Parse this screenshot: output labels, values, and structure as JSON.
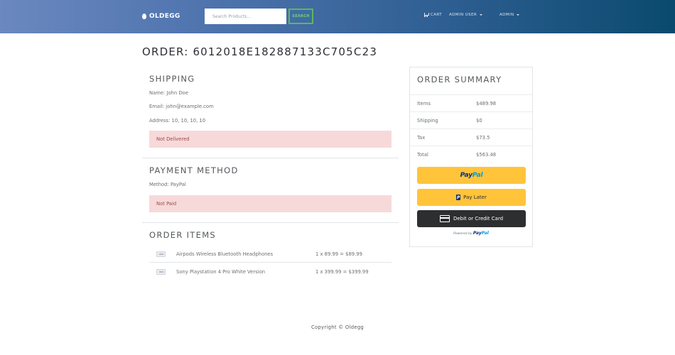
{
  "navbar": {
    "brand": "OLDEGG",
    "search_placeholder": "Search Products...",
    "search_button": "SEARCH",
    "cart": "CART",
    "user_menu": "ADMIN USER",
    "admin_menu": "ADMIN"
  },
  "order": {
    "title": "ORDER: 6012018E182887133C705C23"
  },
  "shipping": {
    "heading": "SHIPPING",
    "name": "Name: John Doe",
    "email": "Email: john@example.com",
    "address": "Address: 10, 10, 10, 10",
    "status": "Not Delivered"
  },
  "payment": {
    "heading": "PAYMENT METHOD",
    "method": "Method: PayPal",
    "status": "Not Paid"
  },
  "order_items": {
    "heading": "ORDER ITEMS",
    "items": [
      {
        "name": "Airpods Wireless Bluetooth Headphones",
        "price": "1 x 89.99 = $89.99"
      },
      {
        "name": "Sony Playstation 4 Pro White Version",
        "price": "1 x 399.99 = $399.99"
      }
    ]
  },
  "summary": {
    "heading": "ORDER SUMMARY",
    "rows": [
      {
        "label": "Items",
        "value": "$489.98"
      },
      {
        "label": "Shipping",
        "value": "$0"
      },
      {
        "label": "Tax",
        "value": "$73.5"
      },
      {
        "label": "Total",
        "value": "$563.48"
      }
    ],
    "paypal": {
      "pay": "Pay",
      "pal": "Pal"
    },
    "pay_later": "Pay Later",
    "card": "Debit or Credit Card",
    "powered_by": "Powered by"
  },
  "footer": {
    "copyright": "Copyright © Oldegg"
  }
}
